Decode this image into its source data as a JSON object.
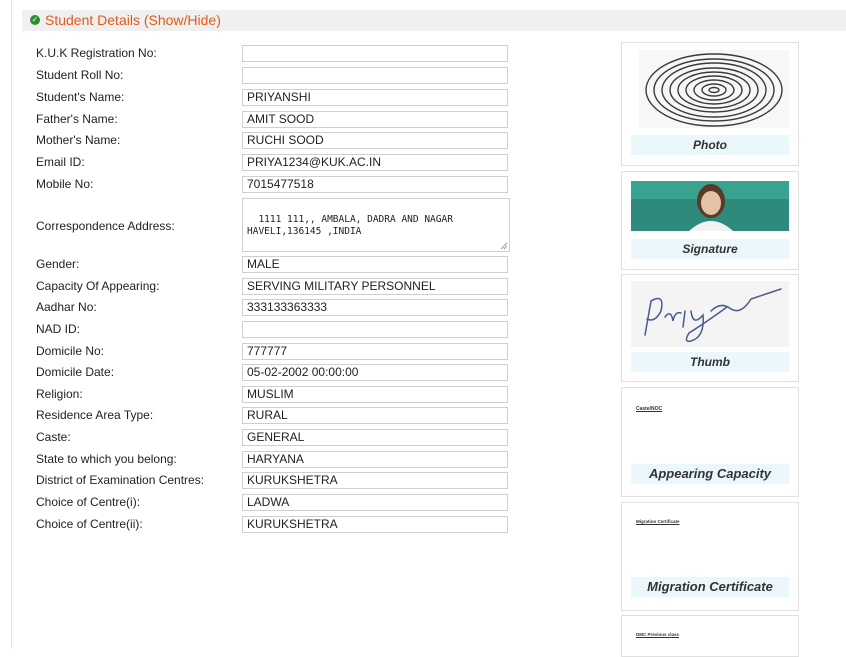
{
  "section": {
    "title": "Student Details (Show/Hide)"
  },
  "fields": [
    {
      "label": "K.U.K Registration No:",
      "value": ""
    },
    {
      "label": "Student Roll No:",
      "value": ""
    },
    {
      "label": "Student's Name:",
      "value": "PRIYANSHI"
    },
    {
      "label": "Father's Name:",
      "value": "AMIT SOOD"
    },
    {
      "label": "Mother's Name:",
      "value": "RUCHI SOOD"
    },
    {
      "label": "Email ID:",
      "value": "PRIYA1234@KUK.AC.IN"
    },
    {
      "label": "Mobile No:",
      "value": "7015477518"
    },
    {
      "label": "Correspondence Address:",
      "value": "1111 111,, AMBALA, DADRA AND NAGAR\nHAVELI,136145 ,INDIA"
    },
    {
      "label": "Gender:",
      "value": "MALE"
    },
    {
      "label": "Capacity Of Appearing:",
      "value": "SERVING MILITARY PERSONNEL"
    },
    {
      "label": "Aadhar No:",
      "value": "333133363333"
    },
    {
      "label": "NAD ID:",
      "value": ""
    },
    {
      "label": "Domicile No:",
      "value": "777777"
    },
    {
      "label": "Domicile Date:",
      "value": "05-02-2002 00:00:00"
    },
    {
      "label": "Religion:",
      "value": "MUSLIM"
    },
    {
      "label": "Residence Area Type:",
      "value": "RURAL"
    },
    {
      "label": "Caste:",
      "value": "GENERAL"
    },
    {
      "label": "State to which you belong:",
      "value": "HARYANA"
    },
    {
      "label": "District of Examination Centres:",
      "value": "KURUKSHETRA"
    },
    {
      "label": "Choice of Centre(i):",
      "value": "LADWA"
    },
    {
      "label": "Choice of Centre(ii):",
      "value": "KURUKSHETRA"
    }
  ],
  "documents": [
    {
      "caption": "Photo"
    },
    {
      "caption": "Signature"
    },
    {
      "caption": "Thumb"
    },
    {
      "caption": "Appearing Capacity",
      "doc_text": "Caste/NOC"
    },
    {
      "caption": "Migration Certificate",
      "doc_text": "Migration Certificate"
    },
    {
      "caption": "",
      "doc_text": "DMC Previous class"
    }
  ],
  "colors": {
    "accent": "#e05a1c",
    "check": "#2e8b2e",
    "caption_bg": "#eaf8fb",
    "header_bg": "#f0f0f0"
  },
  "icons": {
    "section_toggle": "check-circle-icon",
    "textarea_resize": "resize-grip-icon"
  }
}
